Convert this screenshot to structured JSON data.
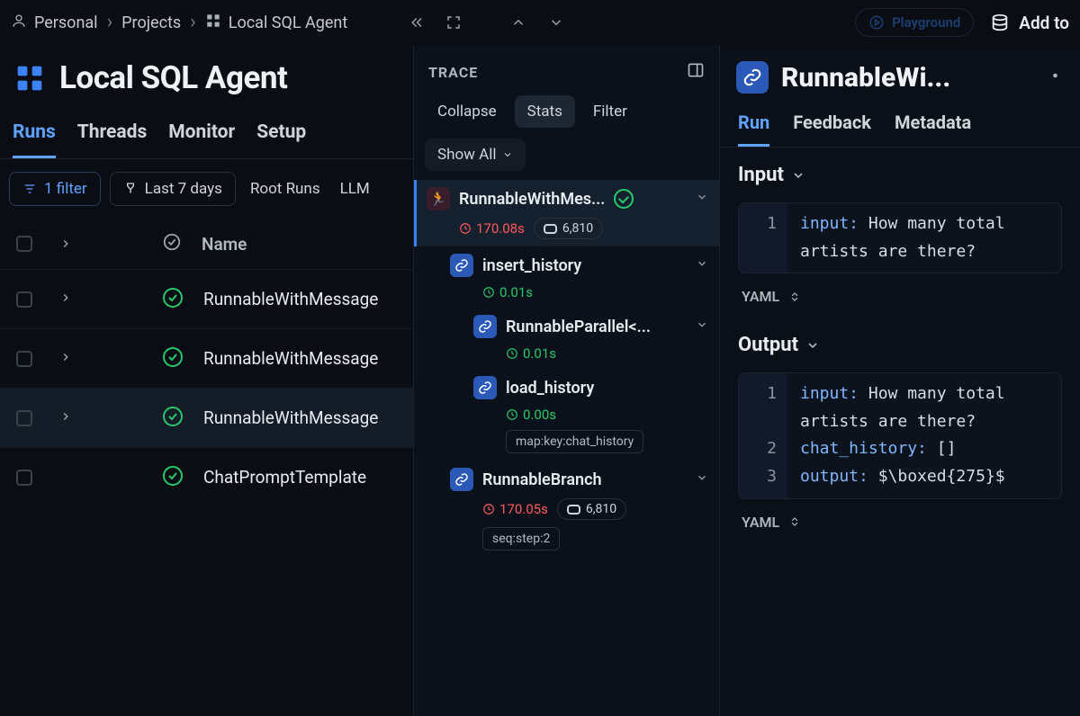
{
  "breadcrumbs": {
    "personal": "Personal",
    "projects": "Projects",
    "current": "Local SQL Agent"
  },
  "topbar": {
    "playground_label": "Playground",
    "add_to_label": "Add to"
  },
  "page": {
    "title": "Local SQL Agent",
    "tabs": {
      "runs": "Runs",
      "threads": "Threads",
      "monitor": "Monitor",
      "setup": "Setup"
    },
    "active_tab": "runs",
    "filters": {
      "filter_count_label": "1 filter",
      "date_label": "Last 7 days",
      "root_label": "Root Runs",
      "llm_label": "LLM"
    },
    "columns": {
      "name": "Name"
    },
    "rows": [
      {
        "name": "RunnableWithMessage",
        "status": "ok",
        "expandable": true,
        "selected": false
      },
      {
        "name": "RunnableWithMessage",
        "status": "ok",
        "expandable": true,
        "selected": false
      },
      {
        "name": "RunnableWithMessage",
        "status": "ok",
        "expandable": true,
        "selected": true
      },
      {
        "name": "ChatPromptTemplate",
        "status": "ok",
        "expandable": false,
        "selected": false
      }
    ]
  },
  "trace": {
    "header": "TRACE",
    "controls": {
      "collapse": "Collapse",
      "stats": "Stats",
      "filter": "Filter",
      "show_all": "Show All"
    },
    "nodes": [
      {
        "id": "root",
        "name": "RunnableWithMes...",
        "icon": "run",
        "time": "170.08s",
        "time_kind": "red",
        "tokens": "6,810",
        "status": "ok",
        "indent": 0,
        "expand": "expanded",
        "selected": true
      },
      {
        "id": "ih",
        "name": "insert_history",
        "icon": "link",
        "time": "0.01s",
        "time_kind": "green",
        "indent": 1,
        "expand": "collapsible"
      },
      {
        "id": "rp",
        "name": "RunnableParallel<...",
        "icon": "link",
        "time": "0.01s",
        "time_kind": "green",
        "indent": 2,
        "expand": "collapsible"
      },
      {
        "id": "lh",
        "name": "load_history",
        "icon": "link",
        "time": "0.00s",
        "time_kind": "green",
        "indent": 2,
        "tag": "map:key:chat_history"
      },
      {
        "id": "rb",
        "name": "RunnableBranch",
        "icon": "link",
        "time": "170.05s",
        "time_kind": "red",
        "tokens": "6,810",
        "indent": 1,
        "expand": "collapsible",
        "tag": "seq:step:2"
      }
    ]
  },
  "detail": {
    "title": "RunnableWi...",
    "tabs": {
      "run": "Run",
      "feedback": "Feedback",
      "metadata": "Metadata"
    },
    "active_tab": "run",
    "input_header": "Input",
    "output_header": "Output",
    "format_label": "YAML",
    "input_lines": [
      {
        "n": "1",
        "key": "input:",
        "val": " How many total"
      },
      {
        "n": "",
        "key": "",
        "val": "artists are there?"
      }
    ],
    "output_lines": [
      {
        "n": "1",
        "key": "input:",
        "val": " How many total"
      },
      {
        "n": "",
        "key": "",
        "val": "artists are there?"
      },
      {
        "n": "2",
        "key": "chat_history:",
        "val": " []"
      },
      {
        "n": "3",
        "key": "output:",
        "val": " $\\boxed{275}$"
      }
    ]
  }
}
